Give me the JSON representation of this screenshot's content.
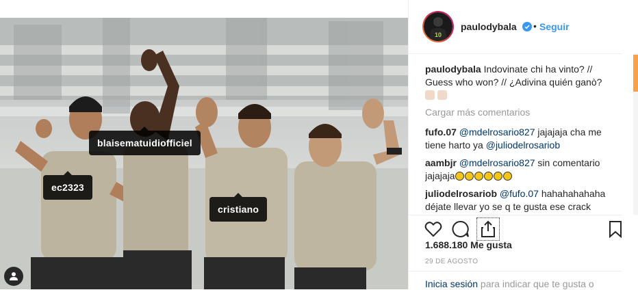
{
  "photo": {
    "tags": [
      {
        "label": "blaisematuidiofficiel"
      },
      {
        "label": "ec2323"
      },
      {
        "label": "cristiano"
      }
    ],
    "user_tag_icon": "person-icon"
  },
  "post": {
    "username": "paulodybala",
    "verified_icon": "verified-badge-icon",
    "separator": "•",
    "follow_label": "Seguir",
    "caption_user": "paulodybala",
    "caption_text": "Indovinate chi ha vinto? // Guess who won? // ¿Adivina quién ganò?",
    "load_more": "Cargar más comentarios",
    "comments": [
      {
        "user": "fufo.07",
        "mention": "@mdelrosario827",
        "text": " jajajaja cha me tiene harto ya ",
        "mention2": "@juliodelrosariob",
        "text2": ""
      },
      {
        "user": "aambjr",
        "mention": "@mdelrosario827",
        "text": " sin comentario jajajaja",
        "mention2": "",
        "text2": ""
      },
      {
        "user": "juliodelrosariob",
        "mention": "@fufo.07",
        "text": " hahahahahaha déjate llevar yo se q te gusta ese crack como juega y te demuestra q es mejor q",
        "mention2": "",
        "text2": ""
      }
    ],
    "likes": "1.688.180 Me gusta",
    "date": "29 DE AGOSTO",
    "login_link": "Inicia sesión",
    "login_text": " para indicar que te gusta o"
  },
  "colors": {
    "link_blue": "#3897f0",
    "mention_blue": "#003569",
    "muted": "#999999",
    "scroll_accent": "#f7a24a"
  }
}
